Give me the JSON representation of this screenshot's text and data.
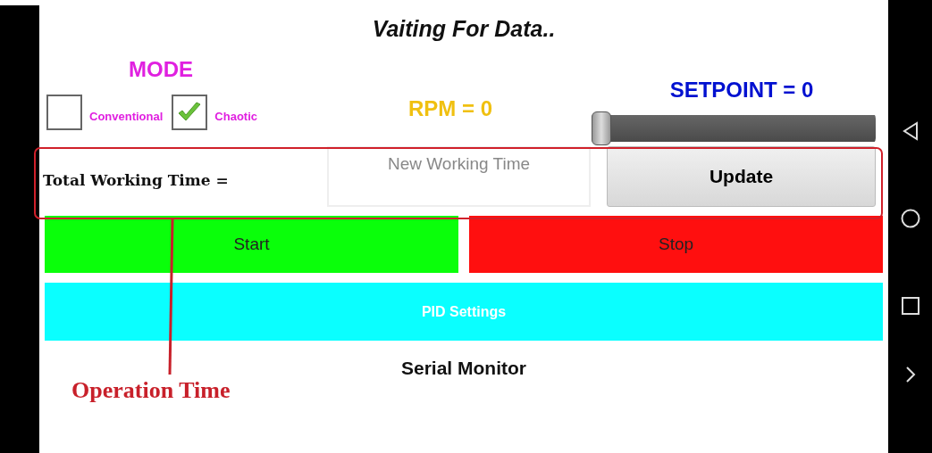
{
  "title": "Vaiting For Data..",
  "mode": {
    "label": "MODE",
    "options": [
      {
        "label": "Conventional",
        "checked": false
      },
      {
        "label": "Chaotic",
        "checked": true
      }
    ]
  },
  "rpm": "RPM = 0",
  "setpoint": {
    "label": "SETPOINT = 0",
    "level": 0
  },
  "working_time": {
    "label": "Total Working Time =",
    "placeholder": "New Working Time",
    "button": "Update"
  },
  "buttons": [
    {
      "label": "Start",
      "kind": "start"
    },
    {
      "label": "Stop",
      "kind": "stop"
    }
  ],
  "pid_settings": "PID Settings",
  "serial_monitor": "Serial Monitor",
  "annotation": {
    "label": "Operation Time"
  }
}
